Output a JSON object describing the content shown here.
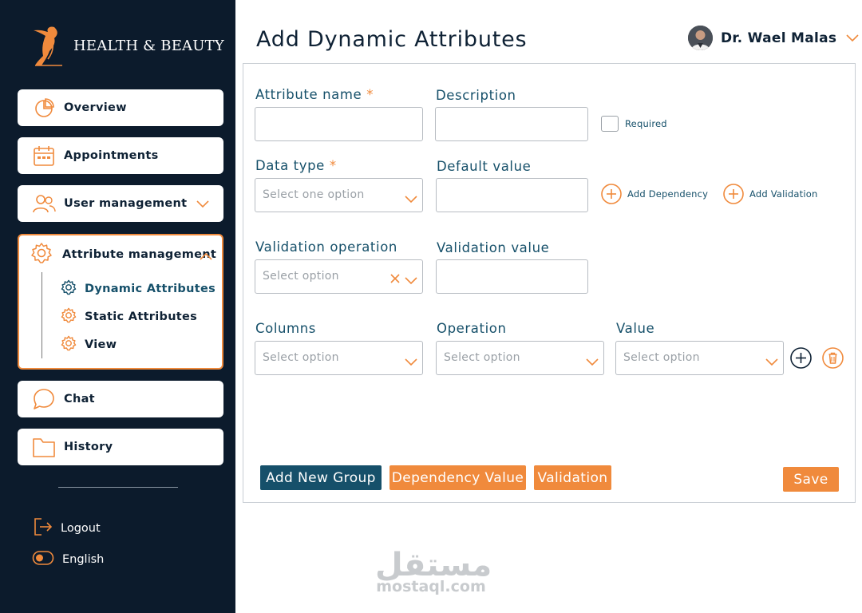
{
  "brand": {
    "name": "HEALTH & BEAUTY",
    "accent": "#f08a3c",
    "sidebar_bg": "#0c1b2c",
    "primary": "#16506a"
  },
  "sidebar": {
    "overview": "Overview",
    "appointments": "Appointments",
    "user_management": "User management",
    "attribute_management": "Attribute management",
    "sub_items": [
      "Dynamic Attributes",
      "Static Attributes",
      "View"
    ],
    "chat": "Chat",
    "history": "History",
    "logout": "Logout",
    "language": "English"
  },
  "header": {
    "title": "Add Dynamic Attributes",
    "user_name": "Dr. Wael Malas"
  },
  "form": {
    "attribute_name_label": "Attribute name",
    "required_star": "*",
    "description_label": "Description",
    "required_label": "Required",
    "data_type_label": "Data type",
    "data_type_placeholder": "Select one option",
    "default_value_label": "Default value",
    "add_dependency": "Add Dependency",
    "add_validation": "Add Validation",
    "validation_operation_label": "Validation operation",
    "validation_operation_placeholder": "Select option",
    "validation_value_label": "Validation value",
    "columns_label": "Columns",
    "columns_placeholder": "Select option",
    "operation_label": "Operation",
    "operation_placeholder": "Select option",
    "value_label": "Value",
    "value_placeholder": "Select option"
  },
  "buttons": {
    "add_new_group": "Add New Group",
    "dependency_value": "Dependency Value",
    "validation": "Validation",
    "save": "Save"
  },
  "watermark": {
    "arabic": "مستقل",
    "latin": "mostaql.com"
  }
}
